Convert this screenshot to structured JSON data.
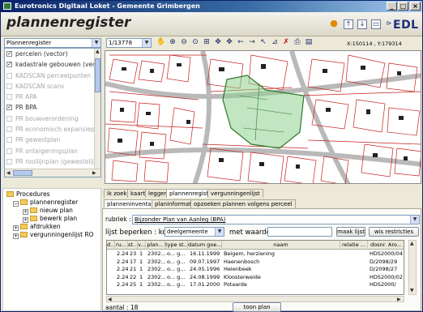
{
  "window": {
    "title": "Eurotronics Digitaal Loket - Gemeente Grimbergen",
    "minimize": "_",
    "maximize": "□",
    "close": "×"
  },
  "header": {
    "app_title": "plannenregister",
    "logo": "EDL",
    "icons": [
      "info-icon",
      "up-icon",
      "down-icon",
      "window-icon",
      "pin-icon"
    ]
  },
  "layers": {
    "selected": "Plannenregister",
    "items": [
      {
        "label": "percelen (vector)",
        "checked": true,
        "enabled": true
      },
      {
        "label": "kadastrale gebouwen (vec",
        "checked": true,
        "enabled": true
      },
      {
        "label": "KADSCAN perceelpunten",
        "checked": false,
        "enabled": false
      },
      {
        "label": "KADSCAN scans",
        "checked": false,
        "enabled": false
      },
      {
        "label": "PR APA",
        "checked": false,
        "enabled": false
      },
      {
        "label": "PR BPA",
        "checked": true,
        "enabled": true
      },
      {
        "label": "PR bouwverordening",
        "checked": false,
        "enabled": false
      },
      {
        "label": "PR economisch expansiep",
        "checked": false,
        "enabled": false
      },
      {
        "label": "PR gewestplan",
        "checked": false,
        "enabled": false
      },
      {
        "label": "PR onteigeningsplan",
        "checked": false,
        "enabled": false
      },
      {
        "label": "PR rooilijnplan (gewestelijk",
        "checked": false,
        "enabled": false
      },
      {
        "label": "PR rooilijnplan (provinciaa",
        "checked": false,
        "enabled": false
      },
      {
        "label": "PR rooilijnplan (gemeente",
        "checked": false,
        "enabled": false
      }
    ]
  },
  "map_toolbar": {
    "scale": "1/13778",
    "tools": [
      "pan-icon",
      "zoom-in-icon",
      "zoom-out-icon",
      "zoom-extent-icon",
      "zoom-window-icon",
      "move-icon",
      "previous-icon",
      "next-icon",
      "select-icon",
      "measure-icon",
      "clear-icon",
      "print-icon",
      "export-icon"
    ],
    "coordinates": "X:150114 , Y:179314"
  },
  "tree": {
    "items": [
      {
        "label": "Procedures",
        "level": 0
      },
      {
        "label": "plannenregister",
        "level": 1,
        "expander": "−"
      },
      {
        "label": "nieuw plan",
        "level": 2,
        "expander": "+"
      },
      {
        "label": "bewerk plan",
        "level": 2,
        "expander": "+"
      },
      {
        "label": "afdrukken",
        "level": 1,
        "expander": "+"
      },
      {
        "label": "vergunningenlijst RO",
        "level": 1,
        "expander": "+"
      }
    ]
  },
  "tabs_top": [
    "ik zoek",
    "kaart",
    "legger",
    "plannenregister",
    "vergunningenlijst"
  ],
  "tabs_sub": [
    "planneninventaris",
    "planinformatie",
    "opzoeken plannen volgens perceel"
  ],
  "search": {
    "rubriek_label": "rubriek :",
    "rubriek_value": "Bijzonder Plan van Aanleg (BPA)",
    "lijst_label": "lijst beperken : kolom",
    "kolom_value": "deelgemeente",
    "waarde_label": "met waarde",
    "waarde_value": "",
    "maak_button": "maak lijst",
    "wis_button": "wis restricties"
  },
  "table": {
    "columns": [
      "d...",
      "ru...",
      "st...",
      "v...",
      "plan...",
      "type st...",
      "datum goe...",
      "naam",
      "relatie ...",
      "dosnr. Aro..."
    ],
    "rows": [
      [
        "",
        "2.24",
        "23",
        "1",
        "2302...",
        "o... g...",
        "16.11.1999",
        "Beigem, herziening",
        "",
        "HDS2000/04"
      ],
      [
        "",
        "2.24",
        "17",
        "1",
        "2302...",
        "o... g...",
        "09.07.1997",
        "Haenenbosch",
        "",
        "D/2098/29"
      ],
      [
        "",
        "2.24",
        "21",
        "1",
        "2302...",
        "o... g...",
        "24.05.1996",
        "Heienbeek",
        "",
        "D/2098/27"
      ],
      [
        "",
        "2.24",
        "22",
        "1",
        "2302...",
        "o... g...",
        "24.08.1999",
        "Kloosterweide",
        "",
        "HDS2000/02"
      ],
      [
        "",
        "2.24",
        "25",
        "1",
        "2302...",
        "o... g...",
        "17.01.2000",
        "Potaarde",
        "",
        "HDS2000/"
      ]
    ]
  },
  "footer": {
    "count": "aantal : 18",
    "show_button": "toon plan"
  }
}
